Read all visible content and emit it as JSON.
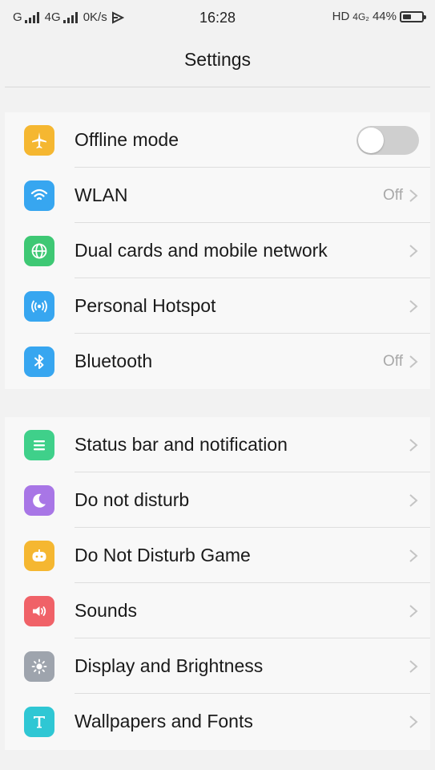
{
  "status_bar": {
    "left_text_1": "G",
    "left_text_2": "4G",
    "net_speed": "0K/s",
    "time": "16:28",
    "right_label": "HD",
    "network_type": "4G₂",
    "battery": "44%",
    "battery_level_percent": 44
  },
  "header": {
    "title": "Settings"
  },
  "group1": [
    {
      "label": "Offline mode",
      "icon": "airplane-icon",
      "color": "#f5b731",
      "control": "toggle",
      "toggle_on": false
    },
    {
      "label": "WLAN",
      "icon": "wifi-icon",
      "color": "#37a6f0",
      "value": "Off"
    },
    {
      "label": "Dual cards and mobile network",
      "icon": "globe-icon",
      "color": "#3ec874"
    },
    {
      "label": "Personal Hotspot",
      "icon": "hotspot-icon",
      "color": "#37a6f0"
    },
    {
      "label": "Bluetooth",
      "icon": "bluetooth-icon",
      "color": "#37a6f0",
      "value": "Off"
    }
  ],
  "group2": [
    {
      "label": "Status bar and notification",
      "icon": "list-icon",
      "color": "#3fd08a"
    },
    {
      "label": "Do not disturb",
      "icon": "moon-icon",
      "color": "#a876e6"
    },
    {
      "label": "Do Not Disturb Game",
      "icon": "game-icon",
      "color": "#f5b731"
    },
    {
      "label": "Sounds",
      "icon": "speaker-icon",
      "color": "#f06268"
    },
    {
      "label": "Display and Brightness",
      "icon": "sun-icon",
      "color": "#9ea4ad"
    },
    {
      "label": "Wallpapers and Fonts",
      "icon": "font-icon",
      "color": "#2fc7d4"
    }
  ]
}
